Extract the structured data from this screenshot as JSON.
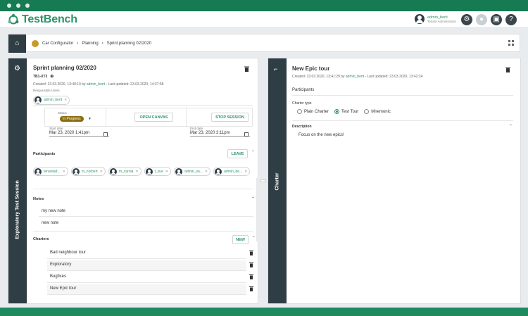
{
  "app": {
    "name": "TestBench"
  },
  "user": {
    "name": "admin_berit",
    "role": "Tenant Administrator"
  },
  "breadcrumb": {
    "items": [
      "Car Configurator",
      "Planning",
      "Sprint planning 02/2020"
    ]
  },
  "session": {
    "vertical_label": "Exploratory Test Session",
    "title": "Sprint planning 02/2020",
    "id": "TB1-XT3",
    "created_prefix": "Created: 23.03.2020, 13:40:10 by",
    "created_by": "admin_berit",
    "last_updated": "- Last updated: 23.03.2020, 14:37:58",
    "responsible_label": "Responsible Users",
    "responsible_user": "admin_berit",
    "status_label": "Status",
    "status_value": "In Progress",
    "open_canvas": "OPEN CANVAS",
    "stop_session": "STOP SESSION",
    "start_label": "Start date",
    "start_value": "Mar 23, 2020 1:41pm",
    "end_label": "End date",
    "end_value": "Mar 23, 2020 3:11pm",
    "participants_label": "Participants",
    "leave_label": "LEAVE",
    "participants": [
      "tenantad...",
      "m_norbert",
      "m_carola",
      "t_sue",
      "admin_sa...",
      "admin_be..."
    ],
    "notes_label": "Notes",
    "notes": [
      "my new note",
      "new note"
    ],
    "charters_label": "Charters",
    "new_label": "NEW",
    "charters": [
      "Bad neighbour tour",
      "Exploratory",
      "Bugfixes",
      "New Epic tour"
    ]
  },
  "charter": {
    "vertical_label": "Charter",
    "title": "New Epic tour",
    "created_prefix": "Created: 23.03.2020, 13:41:29 by",
    "created_by": "admin_berit",
    "last_updated": "- Last updated: 23.03.2020, 13:42:24",
    "participants_label": "Participants",
    "type_label": "Charter type",
    "types": [
      "Plain Charter",
      "Test Tour",
      "Mnemonic"
    ],
    "selected_type": "Test Tour",
    "description_label": "Description",
    "description": "Focus on the new epics!"
  },
  "colors": {
    "accent": "#2b9468",
    "dark": "#2f3d44",
    "brand_green": "#1f8a5e",
    "status": "#8a6d12"
  }
}
